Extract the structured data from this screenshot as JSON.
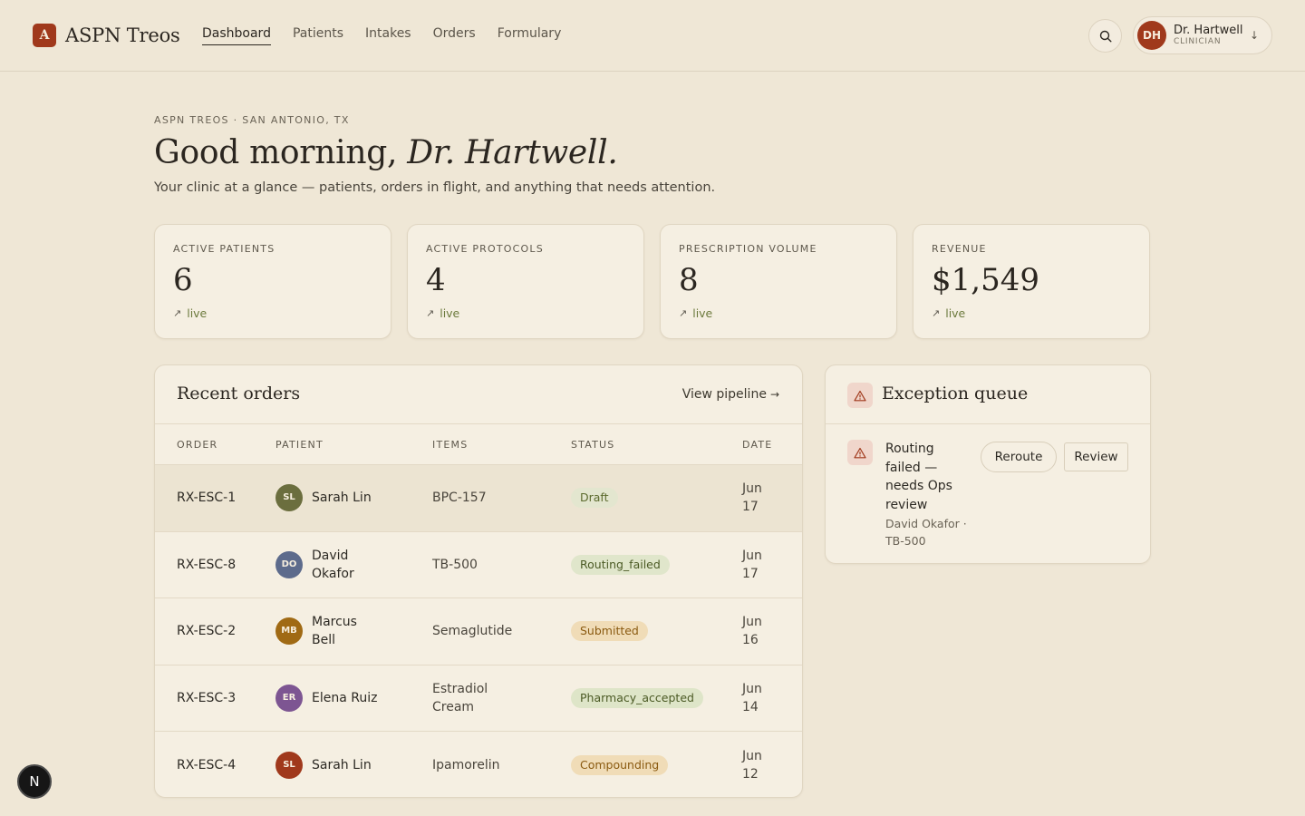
{
  "app": {
    "logo_letter": "A",
    "name": "ASPN Treos"
  },
  "nav": {
    "items": [
      {
        "label": "Dashboard",
        "active": true
      },
      {
        "label": "Patients",
        "active": false
      },
      {
        "label": "Intakes",
        "active": false
      },
      {
        "label": "Orders",
        "active": false
      },
      {
        "label": "Formulary",
        "active": false
      }
    ]
  },
  "header": {
    "search_icon": "search-icon",
    "user": {
      "initials": "DH",
      "name": "Dr. Hartwell",
      "role": "CLINICIAN",
      "caret": "↓"
    }
  },
  "greeting": {
    "eyebrow": "ASPN TREOS · SAN ANTONIO, TX",
    "prefix": "Good morning, ",
    "name": "Dr. Hartwell.",
    "subtitle": "Your clinic at a glance — patients, orders in flight, and anything that needs attention."
  },
  "stats": [
    {
      "label": "ACTIVE PATIENTS",
      "value": "6",
      "trend_arrow": "↗",
      "trend": "live"
    },
    {
      "label": "ACTIVE PROTOCOLS",
      "value": "4",
      "trend_arrow": "↗",
      "trend": "live"
    },
    {
      "label": "PRESCRIPTION VOLUME",
      "value": "8",
      "trend_arrow": "↗",
      "trend": "live"
    },
    {
      "label": "REVENUE",
      "value": "$1,549",
      "trend_arrow": "↗",
      "trend": "live"
    }
  ],
  "recent_orders": {
    "title": "Recent orders",
    "view_link": "View pipeline",
    "view_arrow": "→",
    "columns": [
      "ORDER",
      "PATIENT",
      "ITEMS",
      "STATUS",
      "DATE"
    ],
    "rows": [
      {
        "order": "RX-ESC-1",
        "initials": "SL",
        "patient": "Sarah Lin",
        "avatar_color": "#6b6e3e",
        "items": "BPC-157",
        "status": "Draft",
        "status_bg": "#e3e6cf",
        "status_fg": "#5b6a2d",
        "date": "Jun 17"
      },
      {
        "order": "RX-ESC-8",
        "initials": "DO",
        "patient": "David Okafor",
        "avatar_color": "#5d6b8c",
        "items": "TB-500",
        "status": "Routing_failed",
        "status_bg": "#e0e6cb",
        "status_fg": "#4b5a25",
        "date": "Jun 17"
      },
      {
        "order": "RX-ESC-2",
        "initials": "MB",
        "patient": "Marcus Bell",
        "avatar_color": "#a06a14",
        "items": "Semaglutide",
        "status": "Submitted",
        "status_bg": "#f0dcb7",
        "status_fg": "#8a5a10",
        "date": "Jun 16"
      },
      {
        "order": "RX-ESC-3",
        "initials": "ER",
        "patient": "Elena Ruiz",
        "avatar_color": "#7d5592",
        "items": "Estradiol Cream",
        "status": "Pharmacy_accepted",
        "status_bg": "#dee5c8",
        "status_fg": "#4b5a25",
        "date": "Jun 14"
      },
      {
        "order": "RX-ESC-4",
        "initials": "SL",
        "patient": "Sarah Lin",
        "avatar_color": "#a0391c",
        "items": "Ipamorelin",
        "status": "Compounding",
        "status_bg": "#f0dcb7",
        "status_fg": "#8a5a10",
        "date": "Jun 12"
      }
    ]
  },
  "exception_queue": {
    "title": "Exception queue",
    "item": {
      "title": "Routing failed — needs Ops review",
      "meta": "David Okafor · TB-500",
      "reroute_label": "Reroute",
      "review_label": "Review"
    }
  },
  "floating_badge": "N",
  "colors": {
    "background": "#efe7d6",
    "card": "#f5efe2",
    "brand": "#a0391c",
    "trend": "#6c7a3d"
  }
}
